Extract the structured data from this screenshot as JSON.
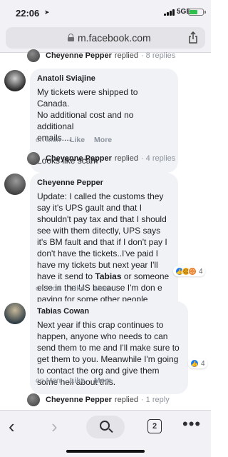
{
  "status_bar": {
    "time": "22:06",
    "network": "5GE"
  },
  "browser": {
    "url": "m.facebook.com",
    "tab_count": "2"
  },
  "reply_links": [
    {
      "name": "Cheyenne Pepper",
      "verb": "replied",
      "count": "· 8 replies"
    },
    {
      "name": "Cheyenne Pepper",
      "verb": "replied",
      "count": "· 4 replies"
    },
    {
      "name": "Cheyenne Pepper",
      "verb": "replied",
      "count": "· 1 reply"
    }
  ],
  "comments": [
    {
      "author": "Anatoli Sviajine",
      "text": "My tickets were shipped to Canada.\nNo additional cost and no additional\nemails....\n\nLooks like scam",
      "time": "on Mon",
      "like": "Like",
      "more": "More"
    },
    {
      "author": "Cheyenne Pepper",
      "text_parts": [
        "Update: I called the customs they say it's UPS gault and that I shouldn't pay tax and that I should see with them ditectly, UPS says it's BM fault and that if I don't pay I don't have the tickets..I've paid I have my tickets but next year I'll have it send to ",
        "Tabias",
        " or someone else in the US because I'm don e paying for some other people mistakes"
      ],
      "time": "on Mon",
      "like": "Like",
      "more": "More",
      "reaction_count": "4"
    },
    {
      "author": "Tabias Cowan",
      "text": "Next year if this crap continues to happen, anyone who needs to can send them to me and I'll make sure to get them to you. Meanwhile I'm going to contact the org and give them some hell about this.",
      "time": "on Mon",
      "like": "Like",
      "more": "More",
      "reaction_count": "4"
    }
  ],
  "icons": {
    "like": "like-reaction-icon",
    "sad": "sad-reaction-icon",
    "angry": "angry-reaction-icon"
  },
  "colors": {
    "like_blue": "#1877f2",
    "bubble_bg": "#f0f2f5"
  }
}
